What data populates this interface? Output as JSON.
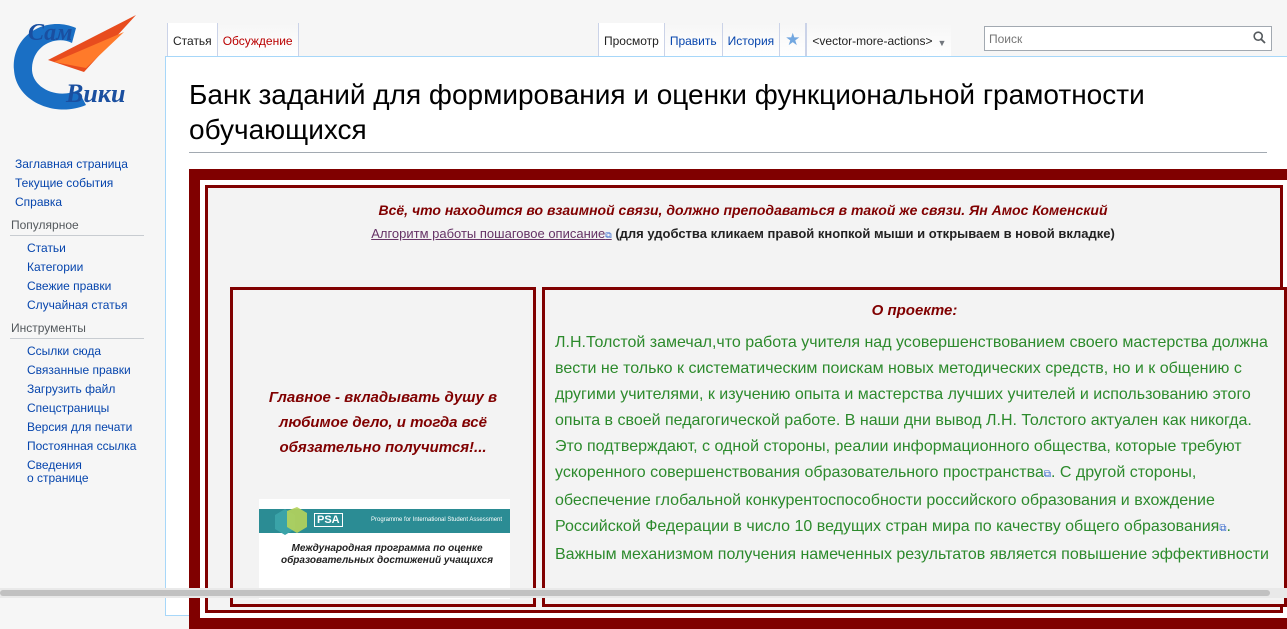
{
  "logo": {
    "top_text": "Сам",
    "bottom_text": "Вики"
  },
  "tabs": {
    "left": [
      {
        "label": "Статья",
        "selected": true
      },
      {
        "label": "Обсуждение",
        "new": true
      }
    ],
    "right": [
      {
        "label": "Просмотр",
        "selected": true
      },
      {
        "label": "Править"
      },
      {
        "label": "История"
      }
    ],
    "more_label": "<vector-more-actions>"
  },
  "search": {
    "placeholder": "Поиск"
  },
  "sidebar": {
    "main": [
      "Заглавная страница",
      "Текущие события",
      "Справка"
    ],
    "popular": {
      "heading": "Популярное",
      "items": [
        "Статьи",
        "Категории",
        "Свежие правки",
        "Случайная статья"
      ]
    },
    "tools": {
      "heading": "Инструменты",
      "items": [
        "Ссылки сюда",
        "Связанные правки",
        "Загрузить файл",
        "Спецстраницы",
        "Версия для печати",
        "Постоянная ссылка"
      ],
      "info_line1": "Сведения",
      "info_line2": "о странице"
    }
  },
  "page": {
    "title": "Банк заданий для формирования и оценки функциональной грамотности обучающихся",
    "quote": "Всё, что находится во взаимной связи, должно преподаваться в такой же связи. Ян Амос Коменский",
    "algorithm_link": "Алгоритм работы пошаговое описание",
    "algorithm_note": "(для удобства кликаем правой кнопкой мыши и открываем в новой вкладке)",
    "motto": "Главное - вкладывать душу в любимое дело, и тогда всё обязательно получится!...",
    "pisa": {
      "logo": "PSA",
      "subtitle": "Programme for International Student Assessment",
      "caption": "Международная программа по оценке образовательных достижений учащихся"
    },
    "about_heading": "О проекте:",
    "about_part1": "Л.Н.Толстой замечал,что работа учителя над усовершенствованием своего мастерства должна вести не только к систематическим поискам новых методических средств, но и к общению с другими учителями, к изучению опыта и мастерства лучших учителей и использованию этого опыта в своей педагогической работе. В наши дни вывод Л.Н. Толстого актуален как никогда. Это подтверждают, с одной стороны, реалии информационного общества, которые требуют ускоренного совершенствования ",
    "about_link1": "образовательного пространства",
    "about_part2": ". С другой стороны, обеспечение глобальной конкурентоспособности российского образования и вхождение Российской Федерации в число 10 ведущих стран мира по качеству ",
    "about_link2": "общего образования",
    "about_part3": ". Важным механизмом получения намеченных результатов является повышение эффективности"
  },
  "colors": {
    "frame": "#800000",
    "about_text": "#2c8a2c",
    "link": "#0645ad"
  }
}
